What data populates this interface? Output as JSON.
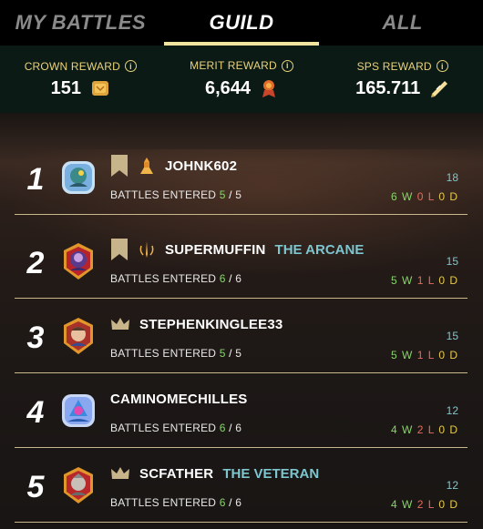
{
  "tabs": [
    {
      "label": "MY BATTLES",
      "active": false
    },
    {
      "label": "GUILD",
      "active": true
    },
    {
      "label": "ALL",
      "active": false
    }
  ],
  "rewards": [
    {
      "label": "CROWN REWARD",
      "value": "151",
      "icon": "crown-reward-icon"
    },
    {
      "label": "MERIT REWARD",
      "value": "6,644",
      "icon": "merit-reward-icon"
    },
    {
      "label": "SPS REWARD",
      "value": "165.711",
      "icon": "sps-reward-icon"
    }
  ],
  "battles_label": "BATTLES ENTERED",
  "players": [
    {
      "rank": "1",
      "name": "JOHNK602",
      "title": "",
      "entered": "5",
      "total": "5",
      "score": "18",
      "w": "6 W",
      "l": "0 L",
      "d": "0 D",
      "badge": "bookmark",
      "role": "tower-icon"
    },
    {
      "rank": "2",
      "name": "SUPERMUFFIN",
      "title": "THE ARCANE",
      "entered": "6",
      "total": "6",
      "score": "15",
      "w": "5 W",
      "l": "1 L",
      "d": "0 D",
      "badge": "bookmark",
      "role": "arcane-icon"
    },
    {
      "rank": "3",
      "name": "STEPHENKINGLEE33",
      "title": "",
      "entered": "5",
      "total": "5",
      "score": "15",
      "w": "5 W",
      "l": "1 L",
      "d": "0 D",
      "badge": "crown",
      "role": ""
    },
    {
      "rank": "4",
      "name": "CAMINOMECHILLES",
      "title": "",
      "entered": "6",
      "total": "6",
      "score": "12",
      "w": "4 W",
      "l": "2 L",
      "d": "0 D",
      "badge": "",
      "role": ""
    },
    {
      "rank": "5",
      "name": "SCFATHER",
      "title": "THE VETERAN",
      "entered": "6",
      "total": "6",
      "score": "12",
      "w": "4 W",
      "l": "2 L",
      "d": "0 D",
      "badge": "crown",
      "role": ""
    }
  ],
  "colors": {
    "accent_gold": "#e8d27a",
    "title_teal": "#7ec6cf",
    "win_green": "#88d46a",
    "loss_red": "#e86b5a",
    "draw_yellow": "#e8c94a"
  }
}
